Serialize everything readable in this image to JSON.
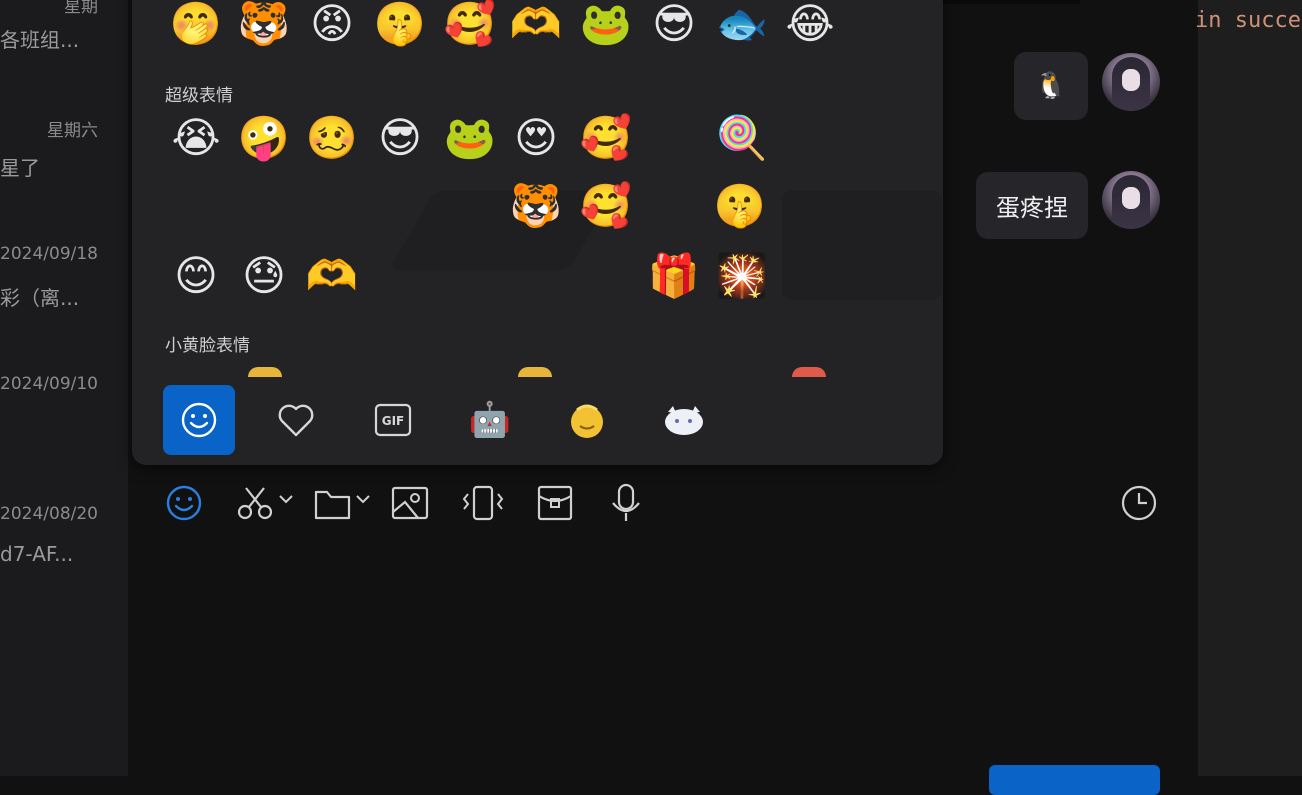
{
  "conversations": [
    {
      "date": "星期",
      "preview": "各班组..."
    },
    {
      "date": "星期六",
      "preview": "星了"
    },
    {
      "date": "2024/09/18",
      "preview": "彩（离..."
    },
    {
      "date": "2024/09/10",
      "preview": ""
    },
    {
      "date": "2024/08/20",
      "preview": "d7-AF..."
    }
  ],
  "code_snippet": "in succe",
  "messages": [
    {
      "type": "sticker",
      "icon": "penguin-sticker",
      "glyph": "🐧"
    },
    {
      "type": "text",
      "text": "蛋疼捏"
    }
  ],
  "emoji_panel": {
    "rows": [
      [
        "🤭",
        "🐯",
        "😡",
        "🤫",
        "🥰",
        "🫶",
        "🐸",
        "😎",
        "🐟",
        "😂"
      ],
      [
        "😭",
        "🤪",
        "🥴",
        "😎",
        "🐸",
        "😍",
        "🥰",
        "",
        "🍭"
      ],
      [
        "",
        "",
        "",
        "",
        "",
        "🐯",
        "🥰",
        "",
        "🤫"
      ],
      [
        "😊",
        "😓",
        "🫶",
        "",
        "",
        "",
        "",
        "🎁",
        "🎇"
      ]
    ],
    "section_super": "超级表情",
    "section_small": "小黄脸表情",
    "tabs": [
      {
        "name": "tab-emoji",
        "glyph": "☺"
      },
      {
        "name": "tab-favorites",
        "glyph": "♡"
      },
      {
        "name": "tab-gif",
        "glyph": "GIF"
      },
      {
        "name": "tab-sticker-pack-1",
        "glyph": "🤖"
      },
      {
        "name": "tab-sticker-pack-2",
        "glyph": "🟡"
      },
      {
        "name": "tab-sticker-pack-3",
        "glyph": "🐱"
      }
    ]
  },
  "toolbar": {
    "icons": [
      "emoji-icon",
      "screenshot-icon",
      "folder-icon",
      "image-icon",
      "shake-icon",
      "red-packet-icon",
      "microphone-icon",
      "history-icon"
    ]
  },
  "colors": {
    "accent": "#0a64c8",
    "panel_bg": "#232325",
    "chat_bg": "#111112"
  }
}
